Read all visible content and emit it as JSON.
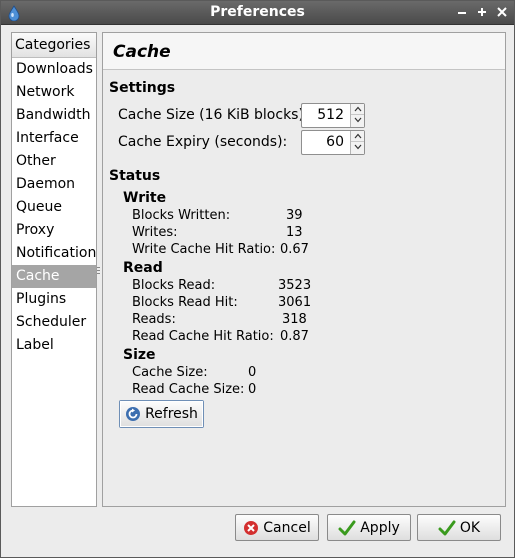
{
  "window": {
    "title": "Preferences"
  },
  "sidebar": {
    "header": "Categories",
    "items": [
      {
        "label": "Downloads",
        "selected": false
      },
      {
        "label": "Network",
        "selected": false
      },
      {
        "label": "Bandwidth",
        "selected": false
      },
      {
        "label": "Interface",
        "selected": false
      },
      {
        "label": "Other",
        "selected": false
      },
      {
        "label": "Daemon",
        "selected": false
      },
      {
        "label": "Queue",
        "selected": false
      },
      {
        "label": "Proxy",
        "selected": false
      },
      {
        "label": "Notification",
        "selected": false
      },
      {
        "label": "Cache",
        "selected": true
      },
      {
        "label": "Plugins",
        "selected": false
      },
      {
        "label": "Scheduler",
        "selected": false
      },
      {
        "label": "Label",
        "selected": false
      }
    ]
  },
  "panel": {
    "title": "Cache",
    "settings": {
      "heading": "Settings",
      "cache_size": {
        "label": "Cache Size (16 KiB blocks):",
        "value": "512"
      },
      "cache_expiry": {
        "label": "Cache Expiry (seconds):",
        "value": "60"
      }
    },
    "status": {
      "heading": "Status",
      "write": {
        "heading": "Write",
        "blocks_written": {
          "label": "Blocks Written:",
          "value": "39"
        },
        "writes": {
          "label": "Writes:",
          "value": "13"
        },
        "write_hit_ratio": {
          "label": "Write Cache Hit Ratio:",
          "value": "0.67"
        }
      },
      "read": {
        "heading": "Read",
        "blocks_read": {
          "label": "Blocks Read:",
          "value": "3523"
        },
        "blocks_read_hit": {
          "label": "Blocks Read Hit:",
          "value": "3061"
        },
        "reads": {
          "label": "Reads:",
          "value": "318"
        },
        "read_hit_ratio": {
          "label": "Read Cache Hit Ratio:",
          "value": "0.87"
        }
      },
      "size": {
        "heading": "Size",
        "cache_size": {
          "label": "Cache Size:",
          "value": "0"
        },
        "read_cache_size": {
          "label": "Read Cache Size:",
          "value": "0"
        }
      }
    },
    "refresh_label": "Refresh"
  },
  "footer": {
    "cancel_label": "Cancel",
    "apply_label": "Apply",
    "ok_label": "OK"
  },
  "icons": {
    "app": "deluge-icon",
    "refresh": "refresh-icon",
    "cancel": "cancel-icon",
    "apply": "checkmark-icon",
    "ok": "checkmark-icon"
  },
  "colors": {
    "titlebar": "#555555",
    "selection": "#a5a5a5",
    "cancel_red": "#d32f2f",
    "check_green": "#3a9a1e",
    "refresh_blue": "#3d6fb0"
  }
}
